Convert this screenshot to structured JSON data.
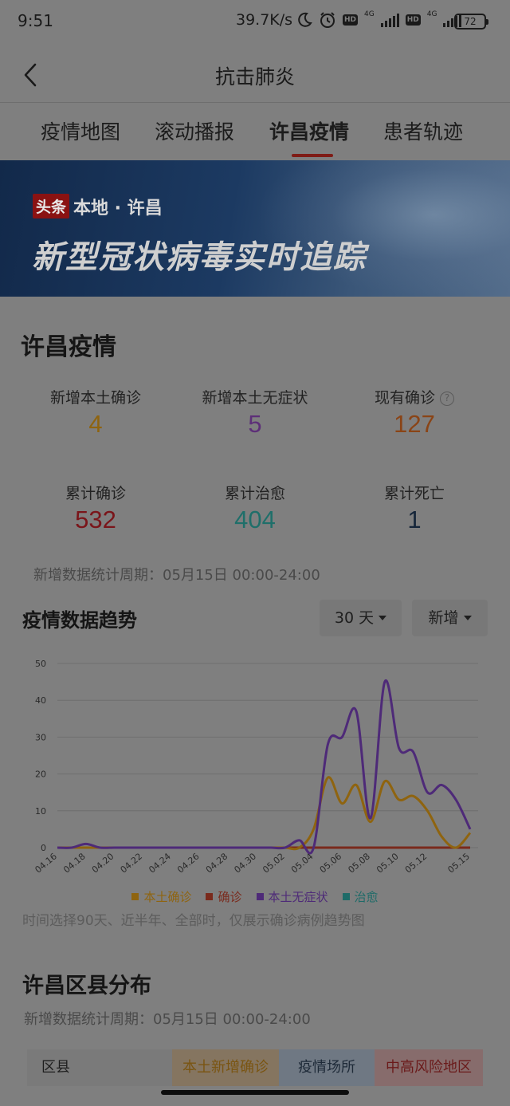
{
  "status_bar": {
    "time": "9:51",
    "speed": "39.7K/s",
    "network1": "4G",
    "network2": "4G",
    "hd": "HD",
    "battery": "72"
  },
  "header": {
    "title": "抗击肺炎",
    "icon": "back-arrow-icon"
  },
  "tabs": [
    {
      "label": "疫情地图"
    },
    {
      "label": "滚动播报"
    },
    {
      "label": "许昌疫情",
      "active": true
    },
    {
      "label": "患者轨迹"
    }
  ],
  "banner": {
    "badge": "头条",
    "location": "本地 · 许昌",
    "headline": "新型冠状病毒实时追踪"
  },
  "section": {
    "title": "许昌疫情",
    "stats": [
      {
        "label": "新增本土确诊",
        "value": "4",
        "color": "#8f640f"
      },
      {
        "label": "新增本土无症状",
        "value": "5",
        "color": "#5d2f78"
      },
      {
        "label": "现有确诊",
        "value": "127",
        "color": "#8a4416",
        "help_icon": "question-circle-icon",
        "help_text": "?"
      },
      {
        "label": "累计确诊",
        "value": "532",
        "color": "#7a151a"
      },
      {
        "label": "累计治愈",
        "value": "404",
        "color": "#1f6f6a"
      },
      {
        "label": "累计死亡",
        "value": "1",
        "color": "#16263a"
      }
    ],
    "period": "新增数据统计周期：05月15日 00:00-24:00"
  },
  "trend": {
    "title": "疫情数据趋势",
    "range_select": "30 天",
    "type_select": "新增",
    "note": "时间选择90天、近半年、全部时，仅展示确诊病例趋势图"
  },
  "chart_data": {
    "type": "line",
    "x": [
      "04.16",
      "04.17",
      "04.18",
      "04.19",
      "04.20",
      "04.21",
      "04.22",
      "04.23",
      "04.24",
      "04.25",
      "04.26",
      "04.27",
      "04.28",
      "04.29",
      "04.30",
      "05.01",
      "05.02",
      "05.03",
      "05.04",
      "05.05",
      "05.06",
      "05.07",
      "05.08",
      "05.09",
      "05.10",
      "05.11",
      "05.12",
      "05.13",
      "05.14",
      "05.15"
    ],
    "x_tick_labels": [
      "04.16",
      "04.18",
      "04.20",
      "04.22",
      "04.24",
      "04.26",
      "04.28",
      "04.30",
      "05.02",
      "05.04",
      "05.06",
      "05.08",
      "05.10",
      "05.12",
      "05.15"
    ],
    "ylim": [
      0,
      50
    ],
    "yticks": [
      0,
      10,
      20,
      30,
      40,
      50
    ],
    "grid": true,
    "legend_position": "bottom",
    "series": [
      {
        "name": "本土确诊",
        "color": "#8f640f",
        "values": [
          0,
          0,
          0,
          0,
          0,
          0,
          0,
          0,
          0,
          0,
          0,
          0,
          0,
          0,
          0,
          0,
          0,
          0,
          5,
          19,
          12,
          17,
          7,
          18,
          13,
          14,
          10,
          3,
          0,
          4
        ]
      },
      {
        "name": "确诊",
        "color": "#7a2a1c",
        "values": [
          0,
          0,
          0,
          0,
          0,
          0,
          0,
          0,
          0,
          0,
          0,
          0,
          0,
          0,
          0,
          0,
          0,
          0,
          0,
          0,
          0,
          0,
          0,
          0,
          0,
          0,
          0,
          0,
          0,
          0
        ]
      },
      {
        "name": "本土无症状",
        "color": "#4e2a78",
        "values": [
          0,
          0,
          1,
          0,
          0,
          0,
          0,
          0,
          0,
          0,
          0,
          0,
          0,
          0,
          0,
          0,
          0,
          2,
          0,
          28,
          30,
          37,
          8,
          45,
          27,
          26,
          15,
          17,
          13,
          5
        ]
      },
      {
        "name": "治愈",
        "color": "#1e6b68",
        "values": [
          0,
          0,
          0,
          0,
          0,
          0,
          0,
          0,
          0,
          0,
          0,
          0,
          0,
          0,
          0,
          0,
          0,
          0,
          0,
          0,
          0,
          0,
          0,
          0,
          0,
          0,
          0,
          0,
          0,
          0
        ]
      }
    ]
  },
  "district": {
    "title": "许昌区县分布",
    "period": "新增数据统计周期：05月15日 00:00-24:00",
    "headers": [
      {
        "label": "区县",
        "bg": "#7a7a7a",
        "color": "#1e1e1e"
      },
      {
        "label": "本土新增确诊",
        "bg": "#857560",
        "color": "#7a5512"
      },
      {
        "label": "疫情场所",
        "bg": "#6f7883",
        "color": "#1e2a38"
      },
      {
        "label": "中高风险地区",
        "bg": "#876c6c",
        "color": "#6a1a1a"
      }
    ]
  }
}
